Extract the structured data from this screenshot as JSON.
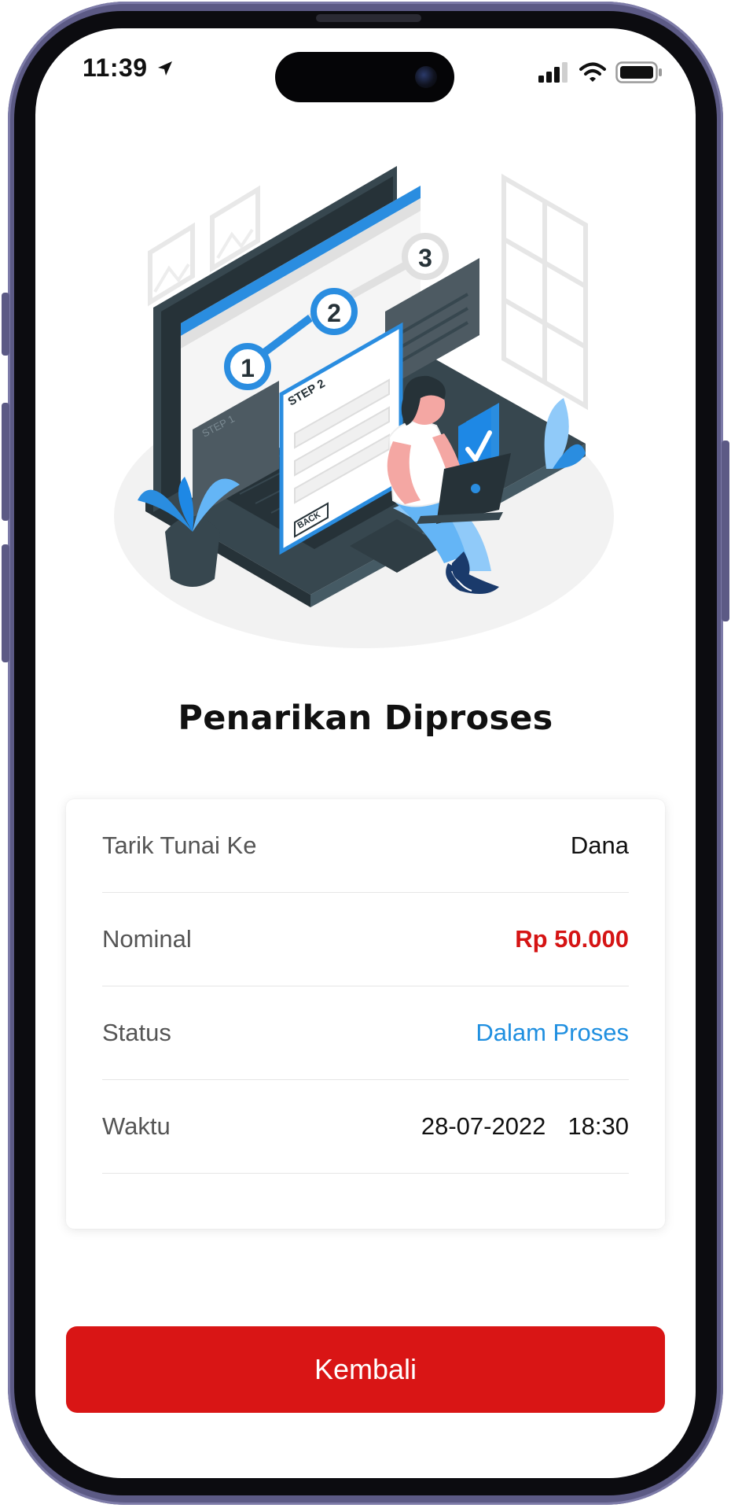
{
  "status_bar": {
    "time": "11:39"
  },
  "illustration": {
    "step_numbers": [
      "1",
      "2",
      "3"
    ],
    "panel_step_1": "STEP 1",
    "panel_step_2": "STEP 2",
    "back_label": "BACK"
  },
  "page": {
    "title": "Penarikan Diproses"
  },
  "details": {
    "rows": [
      {
        "label": "Tarik Tunai Ke",
        "value": "Dana"
      },
      {
        "label": "Nominal",
        "value": "Rp 50.000"
      },
      {
        "label": "Status",
        "value": "Dalam Proses"
      },
      {
        "label": "Waktu",
        "date": "28-07-2022",
        "time": "18:30"
      }
    ]
  },
  "actions": {
    "back_label": "Kembali"
  },
  "colors": {
    "primary": "#d91515",
    "amount": "#d51414",
    "status": "#1f8fe0",
    "illustration_blue": "#2a8de0",
    "illustration_dark": "#37474f"
  }
}
